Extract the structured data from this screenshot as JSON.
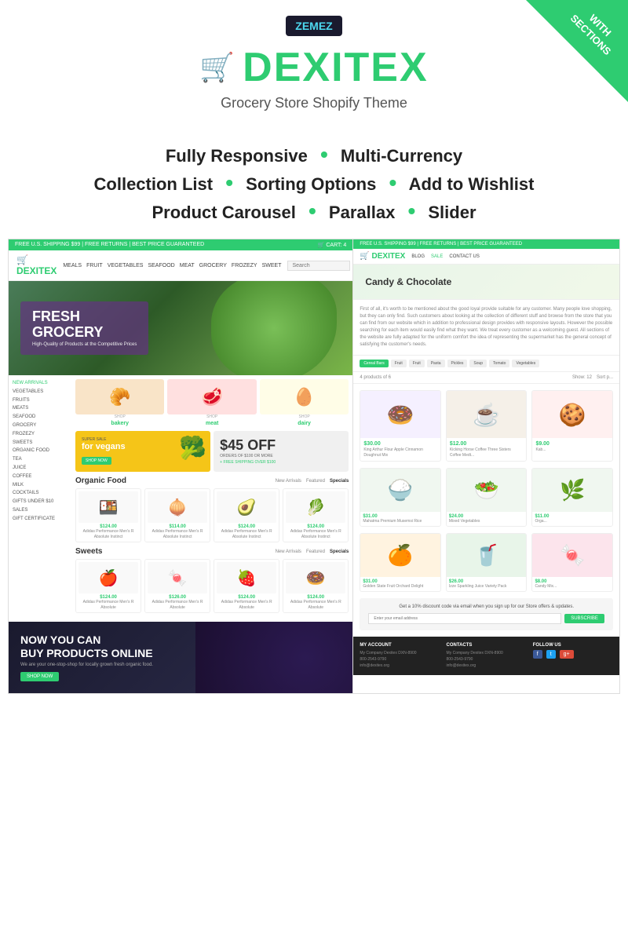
{
  "header": {
    "zemez_label": "ZEMEZ",
    "brand_icon": "🛒",
    "brand_name": "DEXITEX",
    "tagline": "Grocery Store Shopify Theme",
    "corner_line1": "WITH",
    "corner_line2": "SECTIONS"
  },
  "features": {
    "row1": {
      "f1": "Fully Responsive",
      "dot1": "•",
      "f2": "Multi-Currency"
    },
    "row2": {
      "f1": "Collection List",
      "dot1": "•",
      "f2": "Sorting Options",
      "dot2": "•",
      "f3": "Add to Wishlist"
    },
    "row3": {
      "f1": "Product Carousel",
      "dot1": "•",
      "f2": "Parallax",
      "dot2": "•",
      "f3": "Slider"
    }
  },
  "left_preview": {
    "topbar": "FREE U.S. SHIPPING $99  |  FREE RETURNS  |  BEST PRICE GUARANTEED",
    "logo": "🛒 DEXITEX",
    "nav_links": [
      "MEALS",
      "FRUIT",
      "VEGETABLES",
      "SEAFOOD",
      "MEAT",
      "GROCERY",
      "FROZEZY",
      "SWEET"
    ],
    "hero_title": "FRESH\nGROCERY",
    "hero_sub": "High-Quality of Products at the Competitive Prices",
    "sidebar_items": [
      "NEW ARRIVALS",
      "VEGETABLES",
      "FRUITS",
      "MEATS",
      "SEAFOOD",
      "GROCERY",
      "FROZEZY",
      "SWEETS",
      "ORGANIC FOOD",
      "TEA",
      "JUICE",
      "COFFEE",
      "MILK",
      "COCKTAILS",
      "GIFTS UNDER $10",
      "SALES",
      "GIFT CERTIFICATE"
    ],
    "categories": [
      {
        "icon": "🥐",
        "shop": "SHOP",
        "label": "bakery"
      },
      {
        "icon": "🥩",
        "shop": "SHOP",
        "label": "meat"
      },
      {
        "icon": "🥛",
        "shop": "SHOP",
        "label": "dairy"
      }
    ],
    "promo_vegan": "for vegans",
    "promo_discount": "$45 OFF",
    "promo_disc_detail": "ORDERS OF $100 OR MORE",
    "promo_ship": "+ FREE SHIPPING OVER $100",
    "organic_title": "Organic Food",
    "sweets_title": "Sweets",
    "tabs": [
      "New Arrivals",
      "Featured",
      "Specials"
    ],
    "products": [
      {
        "icon": "🍱",
        "price": "$124.00",
        "name": "Adidas Performance Men's R Absolute Instinct Fg Soccer Firm Ground Cleat"
      },
      {
        "icon": "🧅",
        "price": "$114.00",
        "name": "Adidas Performance Men's R Absolute Instinct Fg Soccer Firm Ground Cleat"
      },
      {
        "icon": "🥑",
        "price": "$124.00",
        "name": "Adidas Performance Men's R Absolute Instinct Fg Soccer Firm Ground Cleat"
      },
      {
        "icon": "🥦",
        "price": "$124.00",
        "name": "Adidas Performance Men's R Absolute Instinct Fg Soccer Firm Ground Cleat"
      }
    ],
    "bottom_title": "NOW YOU CAN\nBUY PRODUCTS ONLINE",
    "bottom_sub": "We are your one-stop-shop for locally grown fresh organic food."
  },
  "right_preview": {
    "topbar": "FREE U.S. SHIPPING $99  |  FREE RETURNS  |  BEST PRICE GUARANTEED",
    "logo": "🛒 DEXITEX",
    "nav_links": [
      "BLOG",
      "SALE",
      "CONTACT US"
    ],
    "candy_title": "Candy & Chocolate",
    "desc": "First of all, it's worth to be mentioned about the good loyal provide suitable for any customer. Many people love shopping, but they can only find. Such customers about looking at the collection of different stuff and browse from the store that you can find from our website which in addition to professional design provides with responsive layouts. However the possible searching for each item would easily find what they want. We treat every customer as a welcoming guest. All sections of the website are fully adapted for the uniform comfort the idea of representing the supermarket has the general concept of satisfying the customer's needs.",
    "filter_tags": [
      "Cereal Bars",
      "Fruit",
      "Fruit",
      "Pasta",
      "Pickles",
      "Soup",
      "Tomato",
      "Vegetables"
    ],
    "show_label": "Show: 12",
    "sort_label": "Sort p...",
    "products": [
      {
        "icon": "🍩",
        "price": "$30.00",
        "name": "King Arthur Flour Apple Cinnamon Doughnut Mix",
        "old": ""
      },
      {
        "icon": "☕",
        "price": "$12.00",
        "name": "Kicking Horse Coffee Three Sisters Coffee Medt...",
        "old": ""
      },
      {
        "icon": "🍪",
        "price": "$9.0",
        "name": "Kab...",
        "old": ""
      }
    ],
    "products2": [
      {
        "icon": "🍚",
        "price": "$31.00",
        "name": "Mahatma Premium Musemsi Rice",
        "old": ""
      },
      {
        "icon": "🥗",
        "price": "$24.00",
        "name": "Mixed Vegetables",
        "old": ""
      },
      {
        "icon": "🌿",
        "price": "$11...",
        "name": "Orga...",
        "old": ""
      }
    ],
    "products3": [
      {
        "icon": "🍊",
        "price": "$31.00",
        "name": "Golden State Fruit Orchard Delight Fruit Gourmet",
        "old": ""
      },
      {
        "icon": "🥤",
        "price": "$26.00",
        "name": "Izze Sparkling Juice Variety Pack",
        "old": ""
      },
      {
        "icon": "🍬",
        "price": "...",
        "name": "...",
        "old": ""
      }
    ],
    "promo_text": "Get a 10% discount code via email when you sign up for our Store offers & updates.",
    "subscribe_btn": "SUBSCRIBE",
    "footer_cols": [
      {
        "title": "MY ACCOUNT",
        "items": [
          "My Company Dexitex DXN-8900",
          "800-2543-9790",
          "info@dexitex.org"
        ]
      },
      {
        "title": "CONTACTS",
        "items": [
          "My Company Dexitex DXN-8900",
          "800-2543-9790",
          "info@dexitex.org"
        ]
      },
      {
        "title": "FOLLOW US",
        "items": [
          "f",
          "t",
          "g+"
        ]
      }
    ]
  }
}
